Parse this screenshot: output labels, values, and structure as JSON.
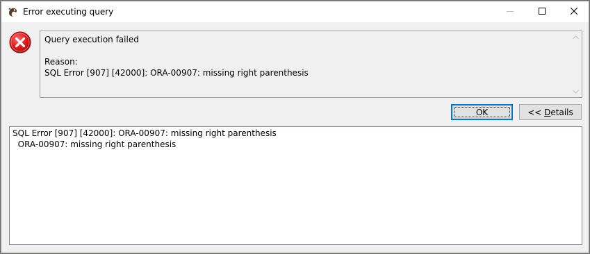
{
  "window": {
    "title": "Error executing query",
    "controls": {
      "minimize_icon": "minimize-icon",
      "maximize_icon": "maximize-icon",
      "close_icon": "close-icon"
    }
  },
  "message": {
    "icon": "error-icon",
    "heading": "Query execution failed",
    "reason_label": "Reason:",
    "reason_text": "SQL Error [907] [42000]: ORA-00907: missing right parenthesis"
  },
  "buttons": {
    "ok_label": "OK",
    "details_prefix": "<< ",
    "details_mnemonic": "D",
    "details_rest": "etails"
  },
  "details": {
    "lines": [
      "SQL Error [907] [42000]: ORA-00907: missing right parenthesis",
      "  ORA-00907: missing right parenthesis"
    ]
  },
  "colors": {
    "error_red": "#e81123",
    "focus_blue": "#0078d7"
  }
}
